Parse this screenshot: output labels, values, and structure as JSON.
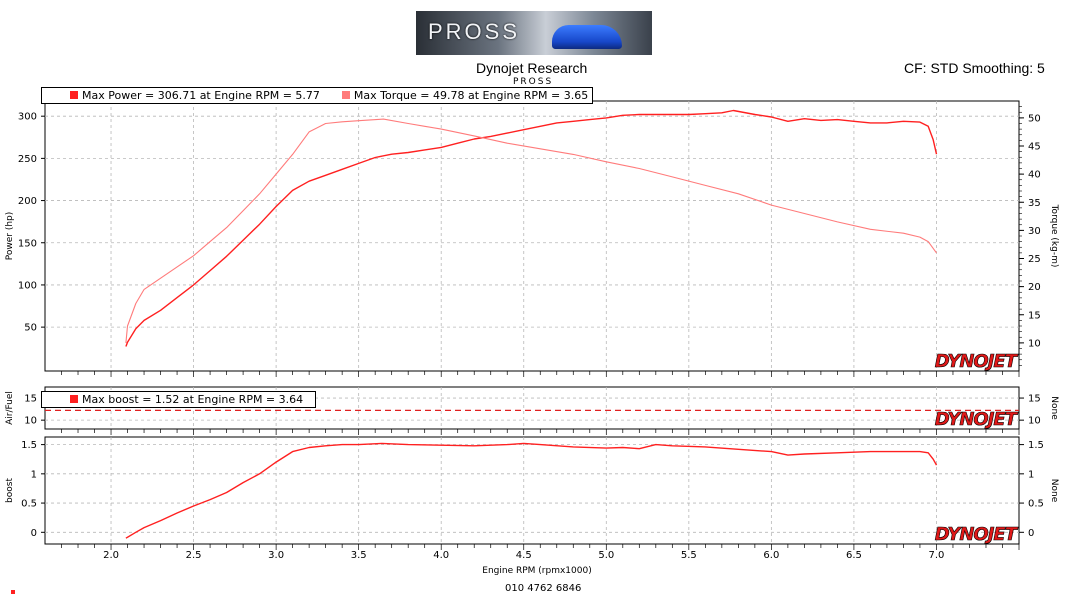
{
  "header": {
    "logo_text": "PROSS",
    "title": "Dynojet Research",
    "subtitle": "PROSS",
    "cf_text": "CF: STD Smoothing: 5",
    "footer_id": "010 4762 6846"
  },
  "colors": {
    "power": "#ff2020",
    "torque": "#ff7b7b",
    "boost": "#ff2020",
    "afr_dashed": "#e02020",
    "grid": "#b8b8b8"
  },
  "chart_data": [
    {
      "type": "line",
      "panel": "power-torque",
      "legend": [
        "Max Power = 306.71 at Engine RPM = 5.77",
        "Max Torque = 49.78 at Engine RPM = 3.65"
      ],
      "ylabel": "Power (hp)",
      "ylabel_right": "Torque (kg-m)",
      "watermark": "DYNOJET",
      "xlim": [
        1.6,
        7.5
      ],
      "ylim": [
        -2,
        318
      ],
      "ylim_right": [
        5,
        53
      ],
      "yticks": [
        50,
        100,
        150,
        200,
        250,
        300
      ],
      "yticks_right": [
        10,
        15,
        20,
        25,
        30,
        35,
        40,
        45,
        50
      ],
      "series": [
        {
          "axis": "left",
          "x": [
            2.09,
            2.1,
            2.15,
            2.2,
            2.3,
            2.4,
            2.5,
            2.6,
            2.7,
            2.8,
            2.9,
            3.0,
            3.1,
            3.2,
            3.3,
            3.4,
            3.5,
            3.6,
            3.7,
            3.8,
            3.9,
            4.0,
            4.1,
            4.2,
            4.3,
            4.4,
            4.5,
            4.6,
            4.7,
            4.8,
            4.9,
            5.0,
            5.1,
            5.2,
            5.3,
            5.4,
            5.5,
            5.6,
            5.7,
            5.77,
            5.9,
            6.0,
            6.1,
            6.2,
            6.3,
            6.4,
            6.5,
            6.6,
            6.7,
            6.8,
            6.9,
            6.95,
            6.98,
            7.0
          ],
          "y": [
            27,
            32,
            48,
            58,
            70,
            85,
            100,
            117,
            134,
            153,
            172,
            193,
            212,
            223,
            230,
            237,
            244,
            251,
            255,
            257,
            260,
            263,
            268,
            273,
            276,
            280,
            284,
            288,
            292,
            294,
            296,
            298,
            301,
            302,
            302,
            302,
            302,
            303,
            304,
            306.71,
            302,
            299,
            294,
            297,
            295,
            296,
            294,
            292,
            292,
            294,
            293,
            288,
            272,
            255
          ]
        },
        {
          "axis": "right",
          "x": [
            2.09,
            2.1,
            2.15,
            2.2,
            2.3,
            2.4,
            2.5,
            2.6,
            2.7,
            2.8,
            2.9,
            3.0,
            3.1,
            3.2,
            3.3,
            3.4,
            3.5,
            3.65,
            3.8,
            3.9,
            4.0,
            4.2,
            4.4,
            4.6,
            4.8,
            5.0,
            5.2,
            5.4,
            5.6,
            5.8,
            6.0,
            6.2,
            6.4,
            6.6,
            6.8,
            6.9,
            6.95,
            7.0
          ],
          "y": [
            10,
            13,
            17,
            19.5,
            21.5,
            23.5,
            25.5,
            28,
            30.5,
            33.5,
            36.5,
            40,
            43.5,
            47.5,
            49,
            49.3,
            49.5,
            49.78,
            49,
            48.5,
            48,
            46.8,
            45.5,
            44.5,
            43.5,
            42.2,
            41,
            39.5,
            38,
            36.5,
            34.5,
            33,
            31.5,
            30.2,
            29.5,
            28.8,
            28,
            26
          ]
        }
      ]
    },
    {
      "type": "line",
      "panel": "air-fuel",
      "legend": [
        "Max boost = 1.52 at Engine RPM = 3.64"
      ],
      "ylabel": "Air/Fuel",
      "ylabel_right": "None",
      "watermark": "DYNOJET",
      "xlim": [
        1.6,
        7.5
      ],
      "ylim": [
        8,
        17.5
      ],
      "yticks": [
        10,
        15
      ],
      "yticks_right": [
        10,
        15
      ],
      "series": [
        {
          "style": "dashed",
          "x": [
            1.6,
            7.5
          ],
          "y": [
            12.2,
            12.2
          ]
        }
      ]
    },
    {
      "type": "line",
      "panel": "boost",
      "ylabel": "boost",
      "ylabel_right": "None",
      "watermark": "DYNOJET",
      "xlabel": "Engine RPM (rpmx1000)",
      "xlim": [
        1.6,
        7.5
      ],
      "ylim": [
        -0.2,
        1.63
      ],
      "yticks": [
        0,
        0.5,
        1.0,
        1.5
      ],
      "yticks_right": [
        0,
        0.5,
        1.0,
        1.5
      ],
      "xticks": [
        2.0,
        2.5,
        3.0,
        3.5,
        4.0,
        4.5,
        5.0,
        5.5,
        6.0,
        6.5,
        7.0
      ],
      "series": [
        {
          "x": [
            2.09,
            2.15,
            2.2,
            2.3,
            2.4,
            2.5,
            2.6,
            2.7,
            2.8,
            2.9,
            3.0,
            3.1,
            3.2,
            3.3,
            3.4,
            3.5,
            3.64,
            3.8,
            4.0,
            4.2,
            4.4,
            4.5,
            4.6,
            4.8,
            5.0,
            5.1,
            5.2,
            5.3,
            5.4,
            5.6,
            5.8,
            6.0,
            6.1,
            6.2,
            6.4,
            6.6,
            6.8,
            6.9,
            6.95,
            6.98,
            7.0
          ],
          "y": [
            -0.1,
            0.0,
            0.08,
            0.2,
            0.33,
            0.45,
            0.56,
            0.68,
            0.85,
            1.0,
            1.2,
            1.38,
            1.45,
            1.48,
            1.5,
            1.5,
            1.52,
            1.5,
            1.49,
            1.48,
            1.5,
            1.52,
            1.5,
            1.46,
            1.44,
            1.45,
            1.43,
            1.5,
            1.48,
            1.46,
            1.42,
            1.38,
            1.32,
            1.34,
            1.36,
            1.38,
            1.38,
            1.38,
            1.36,
            1.25,
            1.15
          ]
        }
      ]
    }
  ]
}
